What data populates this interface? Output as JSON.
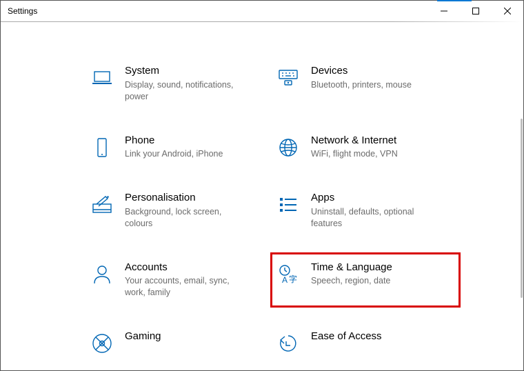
{
  "window": {
    "title": "Settings"
  },
  "tiles": [
    {
      "id": "system",
      "icon": "laptop-icon",
      "title": "System",
      "sub": "Display, sound, notifications, power"
    },
    {
      "id": "devices",
      "icon": "keyboard-icon",
      "title": "Devices",
      "sub": "Bluetooth, printers, mouse"
    },
    {
      "id": "phone",
      "icon": "phone-icon",
      "title": "Phone",
      "sub": "Link your Android, iPhone"
    },
    {
      "id": "network",
      "icon": "globe-icon",
      "title": "Network & Internet",
      "sub": "WiFi, flight mode, VPN"
    },
    {
      "id": "personal",
      "icon": "brush-icon",
      "title": "Personalisation",
      "sub": "Background, lock screen, colours"
    },
    {
      "id": "apps",
      "icon": "apps-icon",
      "title": "Apps",
      "sub": "Uninstall, defaults, optional features"
    },
    {
      "id": "accounts",
      "icon": "person-icon",
      "title": "Accounts",
      "sub": "Your accounts, email, sync, work, family"
    },
    {
      "id": "timelang",
      "icon": "timelang-icon",
      "title": "Time & Language",
      "sub": "Speech, region, date",
      "highlight": true
    },
    {
      "id": "gaming",
      "icon": "gaming-icon",
      "title": "Gaming",
      "sub": ""
    },
    {
      "id": "ease",
      "icon": "ease-icon",
      "title": "Ease of Access",
      "sub": ""
    }
  ]
}
